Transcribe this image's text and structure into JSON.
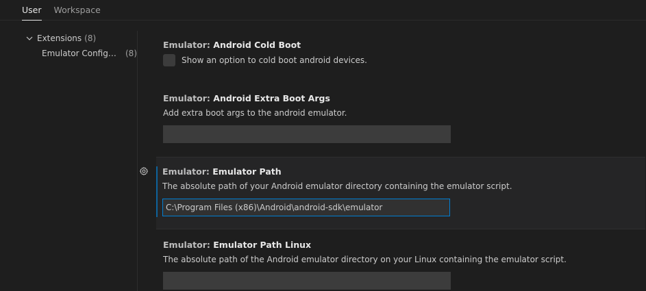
{
  "scope_tabs": [
    {
      "label": "User",
      "active": true
    },
    {
      "label": "Workspace",
      "active": false
    }
  ],
  "toc": {
    "group": {
      "label": "Extensions",
      "count": "(8)",
      "icon": "chevron-down-icon"
    },
    "items": [
      {
        "label": "Emulator Configur...",
        "count": "(8)"
      }
    ]
  },
  "settings": [
    {
      "category": "Emulator: ",
      "name": "Android Cold Boot",
      "type": "checkbox",
      "checked": false,
      "check_label": "Show an option to cold boot android devices."
    },
    {
      "category": "Emulator: ",
      "name": "Android Extra Boot Args",
      "type": "text",
      "description": "Add extra boot args to the android emulator.",
      "value": ""
    },
    {
      "category": "Emulator: ",
      "name": "Emulator Path",
      "type": "text",
      "focused": true,
      "description": "The absolute path of your Android emulator directory containing the emulator script.",
      "value": "C:\\Program Files (x86)\\Android\\android-sdk\\emulator"
    },
    {
      "category": "Emulator: ",
      "name": "Emulator Path Linux",
      "type": "text",
      "description": "The absolute path of the Android emulator directory on your Linux containing the emulator script.",
      "value": ""
    }
  ],
  "colors": {
    "background": "#1e1e1e",
    "focused_row": "#252526",
    "focus_accent": "#007fd4",
    "input_bg": "#3c3c3c"
  }
}
